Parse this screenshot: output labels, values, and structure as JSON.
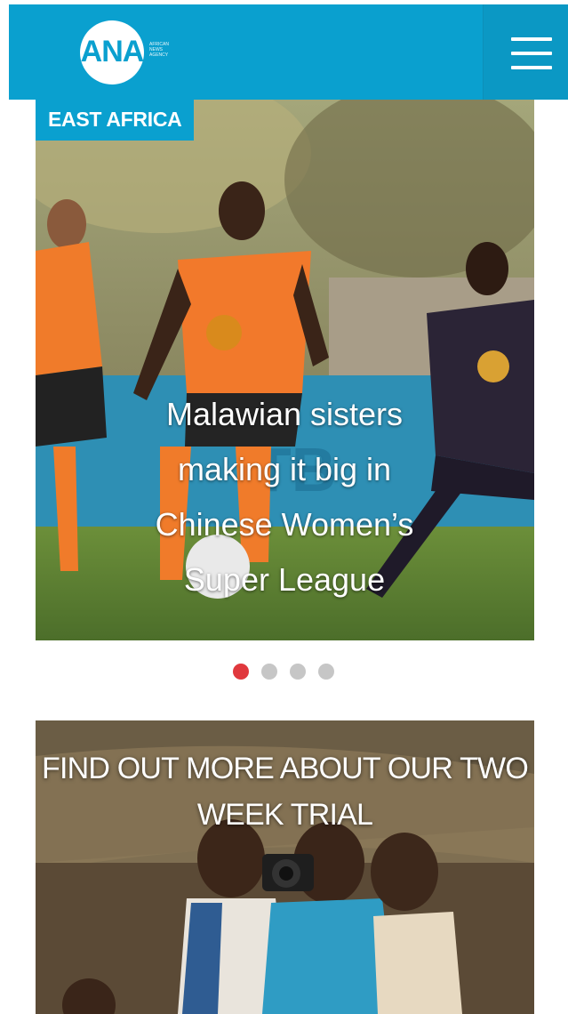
{
  "header": {
    "logo_text": "ANA",
    "logo_tagline": "African News Agency",
    "menu_icon": "hamburger-menu-icon",
    "brand_color": "#0aa0cf"
  },
  "hero": {
    "category": "EAST AFRICA",
    "title": "Malawian sisters making it big in Chinese Women’s Super League"
  },
  "carousel": {
    "slide_count": 4,
    "active_index": 0,
    "active_color": "#e0383d",
    "inactive_color": "#c6c6c6"
  },
  "promo": {
    "title": "FIND OUT MORE ABOUT OUR TWO WEEK TRIAL"
  }
}
